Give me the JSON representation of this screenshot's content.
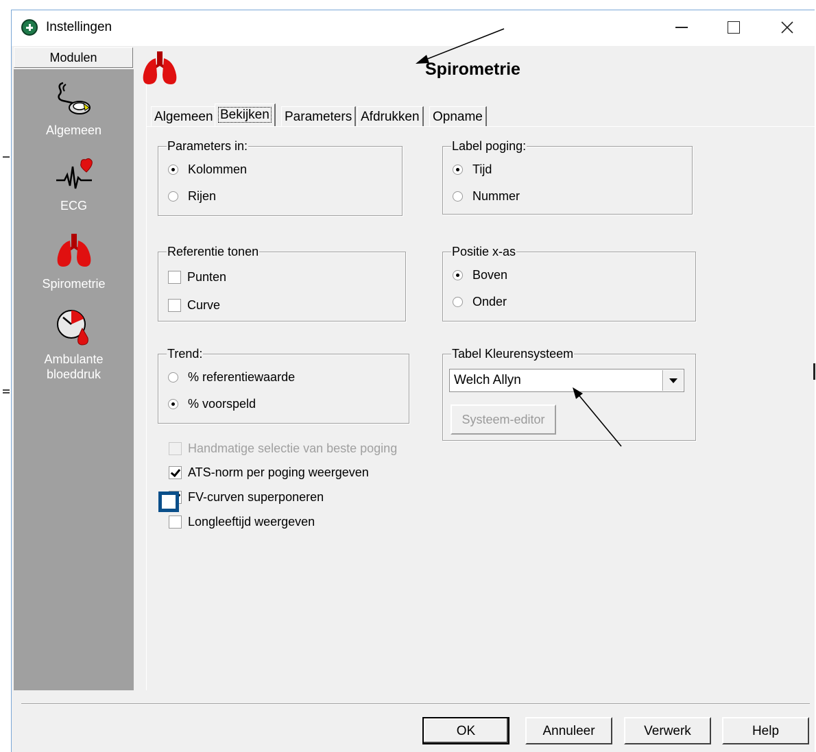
{
  "window": {
    "title": "Instellingen",
    "controls": {
      "minimize": "—",
      "maximize": "☐",
      "close": "✕"
    }
  },
  "sidebar": {
    "header": "Modulen",
    "items": [
      {
        "label": "Algemeen",
        "icon": "stethoscope-icon"
      },
      {
        "label": "ECG",
        "icon": "ecg-heart-icon"
      },
      {
        "label": "Spirometrie",
        "icon": "lungs-icon"
      },
      {
        "label_line1": "Ambulante",
        "label_line2": "bloeddruk",
        "icon": "blood-pressure-clock-icon"
      }
    ]
  },
  "page": {
    "title": "Spirometrie",
    "icon": "lungs-icon"
  },
  "tabs": [
    {
      "label": "Algemeen",
      "active": false
    },
    {
      "label": "Bekijken",
      "active": true
    },
    {
      "label": "Parameters",
      "active": false
    },
    {
      "label": "Afdrukken",
      "active": false
    },
    {
      "label": "Opname",
      "active": false
    }
  ],
  "groups": {
    "parameters_in": {
      "title": "Parameters in:",
      "options": [
        {
          "label": "Kolommen",
          "checked": true
        },
        {
          "label": "Rijen",
          "checked": false
        }
      ]
    },
    "label_poging": {
      "title": "Label poging:",
      "options": [
        {
          "label": "Tijd",
          "checked": true
        },
        {
          "label": "Nummer",
          "checked": false
        }
      ]
    },
    "referentie_tonen": {
      "title": "Referentie tonen",
      "options": [
        {
          "label": "Punten",
          "checked": false
        },
        {
          "label": "Curve",
          "checked": false
        }
      ]
    },
    "positie_xas": {
      "title": "Positie x-as",
      "options": [
        {
          "label": "Boven",
          "checked": true
        },
        {
          "label": "Onder",
          "checked": false
        }
      ]
    },
    "trend": {
      "title": "Trend:",
      "options": [
        {
          "label": "% referentiewaarde",
          "checked": false
        },
        {
          "label": "% voorspeld",
          "checked": true
        }
      ]
    },
    "tabel_kleurensysteem": {
      "title": "Tabel Kleurensysteem",
      "selected": "Welch Allyn",
      "button": "Systeem-editor"
    }
  },
  "checkboxes": [
    {
      "label": "Handmatige selectie van beste poging",
      "checked": false,
      "disabled": true
    },
    {
      "label": "ATS-norm per poging weergeven",
      "checked": true,
      "disabled": false
    },
    {
      "label": "FV-curven superponeren",
      "checked": true,
      "disabled": false
    },
    {
      "label": "Longleeftijd weergeven",
      "checked": false,
      "disabled": false
    }
  ],
  "buttons": {
    "ok": "OK",
    "cancel": "Annuleer",
    "apply": "Verwerk",
    "help": "Help"
  },
  "colors": {
    "sidebar_bg": "#a0a0a0",
    "dialog_bg": "#f0f0f0",
    "lungs_red": "#e01010",
    "annotation_blue": "#0b4f8a"
  }
}
